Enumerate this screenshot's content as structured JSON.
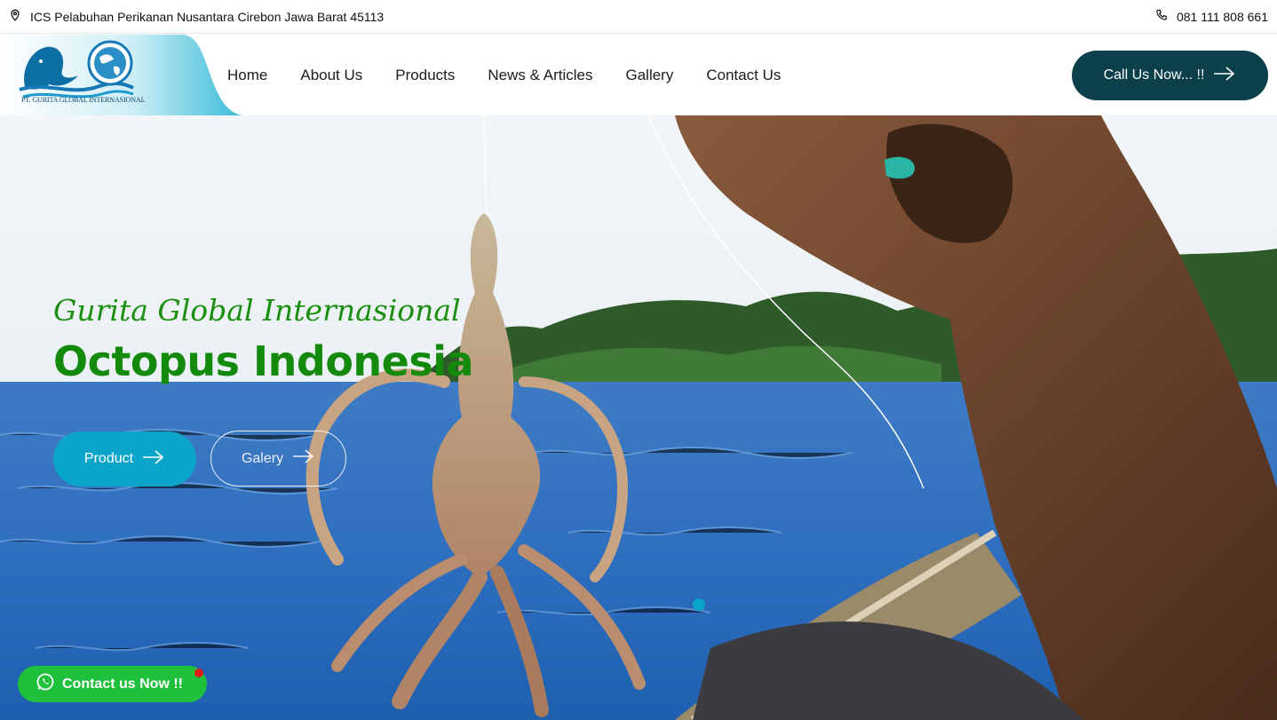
{
  "topbar": {
    "address": "ICS Pelabuhan Perikanan Nusantara Cirebon Jawa Barat 45113",
    "phone": "081 111 808 661",
    "address_icon": "map-pin-icon",
    "phone_icon": "phone-icon"
  },
  "header": {
    "logo_text": "PT. GURITA GLOBAL INTERNASIONAL",
    "nav": [
      "Home",
      "About Us",
      "Products",
      "News & Articles",
      "Gallery",
      "Contact Us"
    ],
    "call_label": "Call Us Now... !!",
    "call_icon": "arrow-right-icon"
  },
  "hero": {
    "subtitle": "Gurita Global Internasional",
    "title": "Octopus Indonesia",
    "product_label": "Product",
    "gallery_label": "Galery",
    "slide_index": 1
  },
  "whatsapp": {
    "label": "Contact us Now !!",
    "icon": "whatsapp-icon"
  },
  "colors": {
    "accent_teal": "#0aa5c9",
    "dark_button": "#0b3f4a",
    "hero_green": "#148a0c",
    "whatsapp_green": "#1ec03c",
    "notification_red": "#e11b1b"
  }
}
